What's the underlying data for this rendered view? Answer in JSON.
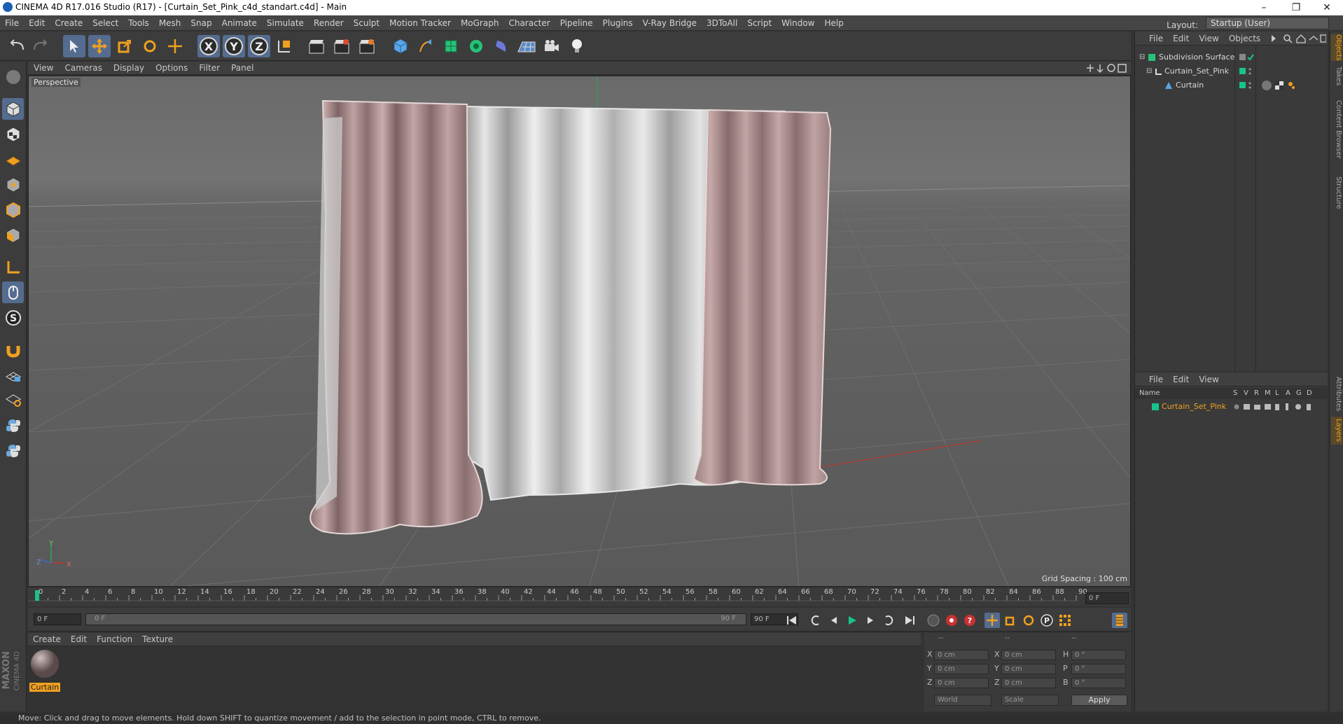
{
  "window": {
    "title": "CINEMA 4D R17.016 Studio (R17) - [Curtain_Set_Pink_c4d_standart.c4d] - Main",
    "minimize": "–",
    "restore": "❐",
    "close": "✕"
  },
  "menubar": {
    "items": [
      "File",
      "Edit",
      "Create",
      "Select",
      "Tools",
      "Mesh",
      "Snap",
      "Animate",
      "Simulate",
      "Render",
      "Sculpt",
      "Motion Tracker",
      "MoGraph",
      "Character",
      "Pipeline",
      "Plugins",
      "V-Ray Bridge",
      "3DToAll",
      "Script",
      "Window",
      "Help"
    ],
    "layout_label": "Layout:",
    "layout_value": "Startup (User)"
  },
  "toolbar": {
    "axis_x": "X",
    "axis_y": "Y",
    "axis_z": "Z"
  },
  "viewport": {
    "menu": [
      "View",
      "Cameras",
      "Display",
      "Options",
      "Filter",
      "Panel"
    ],
    "label": "Perspective",
    "grid_spacing": "Grid Spacing : 100 cm",
    "axis_y": "Y",
    "axis_z": "Z",
    "axis_x": "X"
  },
  "timeline": {
    "ticks": [
      "0",
      "2",
      "4",
      "6",
      "8",
      "10",
      "12",
      "14",
      "16",
      "18",
      "20",
      "22",
      "24",
      "26",
      "28",
      "30",
      "32",
      "34",
      "36",
      "38",
      "40",
      "42",
      "44",
      "46",
      "48",
      "50",
      "52",
      "54",
      "56",
      "58",
      "60",
      "62",
      "64",
      "66",
      "68",
      "70",
      "72",
      "74",
      "76",
      "78",
      "80",
      "82",
      "84",
      "86",
      "88",
      "90"
    ],
    "current_frame": "0 F",
    "start_field": "0 F",
    "range_start": "0 F",
    "range_end": "90 F",
    "end_field": "90 F"
  },
  "material_manager": {
    "menu": [
      "Create",
      "Edit",
      "Function",
      "Texture"
    ],
    "material_name": "Curtain"
  },
  "brand": {
    "maxon": "MAXON",
    "c4d": "CINEMA 4D"
  },
  "coordinates": {
    "header": [
      "--",
      "--",
      "--"
    ],
    "rows": [
      {
        "a": "X",
        "av": "0 cm",
        "b": "X",
        "bv": "0 cm",
        "c": "H",
        "cv": "0 °"
      },
      {
        "a": "Y",
        "av": "0 cm",
        "b": "Y",
        "bv": "0 cm",
        "c": "P",
        "cv": "0 °"
      },
      {
        "a": "Z",
        "av": "0 cm",
        "b": "Z",
        "bv": "0 cm",
        "c": "B",
        "cv": "0 °"
      }
    ],
    "space": "World",
    "mode": "Scale",
    "apply": "Apply"
  },
  "object_manager": {
    "menu": [
      "File",
      "Edit",
      "View",
      "Objects"
    ],
    "objects": [
      "Subdivision Surface",
      "Curtain_Set_Pink",
      "Curtain"
    ]
  },
  "layer_manager": {
    "menu": [
      "File",
      "Edit",
      "View"
    ],
    "col_name": "Name",
    "cols": [
      "S",
      "V",
      "R",
      "M",
      "L",
      "A",
      "G",
      "D"
    ],
    "layer": "Curtain_Set_Pink"
  },
  "right_tabs": [
    "Objects",
    "Takes",
    "Content Browser",
    "Structure",
    "Attributes",
    "Layers"
  ],
  "status": "Move: Click and drag to move elements. Hold down SHIFT to quantize movement / add to the selection in point mode, CTRL to remove.",
  "colors": {
    "accent_green": "#19c38c",
    "orange": "#f0a020",
    "selection_blue": "#546c8f",
    "curtain_pink": "#b09394",
    "curtain_white": "#dcdcdc"
  }
}
